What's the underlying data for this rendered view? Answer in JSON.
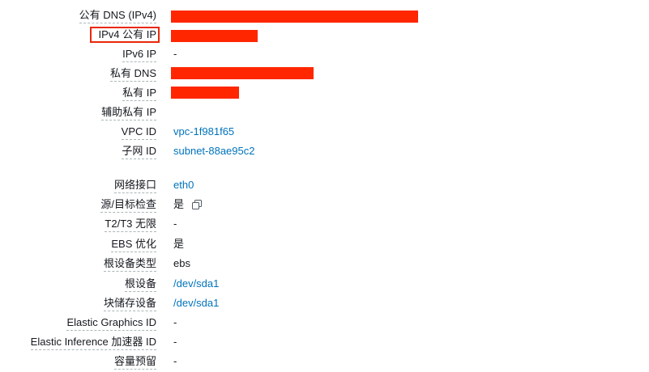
{
  "rows": [
    {
      "label": "公有 DNS (IPv4)",
      "value": ""
    },
    {
      "label": "IPv4 公有 IP",
      "value": ""
    },
    {
      "label": "IPv6 IP",
      "value": "-"
    },
    {
      "label": "私有 DNS",
      "value": ""
    },
    {
      "label": "私有 IP",
      "value": ""
    },
    {
      "label": "辅助私有 IP",
      "value": ""
    },
    {
      "label": "VPC ID",
      "value": "vpc-1f981f65"
    },
    {
      "label": "子网 ID",
      "value": "subnet-88ae95c2"
    },
    {
      "label": "网络接口",
      "value": "eth0"
    },
    {
      "label": "源/目标检查",
      "value": "是"
    },
    {
      "label": "T2/T3 无限",
      "value": "-"
    },
    {
      "label": "EBS 优化",
      "value": "是"
    },
    {
      "label": "根设备类型",
      "value": "ebs"
    },
    {
      "label": "根设备",
      "value": "/dev/sda1"
    },
    {
      "label": "块储存设备",
      "value": "/dev/sda1"
    },
    {
      "label": "Elastic Graphics ID",
      "value": "-"
    },
    {
      "label": "Elastic Inference 加速器 ID",
      "value": "-"
    },
    {
      "label": "容量预留",
      "value": "-"
    }
  ],
  "colors": {
    "redaction": "#ff2600",
    "link": "#0073bb",
    "highlight": "#e8280b"
  },
  "icons": {
    "copy": "copy-icon"
  }
}
